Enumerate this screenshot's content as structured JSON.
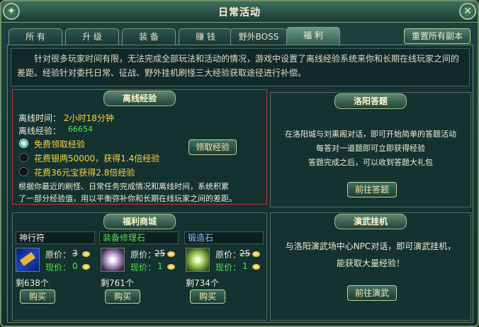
{
  "window": {
    "title": "日常活动"
  },
  "tabs": [
    {
      "label": "所 有"
    },
    {
      "label": "升 级"
    },
    {
      "label": "装 备"
    },
    {
      "label": "赚 钱"
    },
    {
      "label": "野外BOSS"
    },
    {
      "label": "福 利"
    }
  ],
  "reset_button": "重置所有副本",
  "intro": "针对很多玩家时间有限，无法完成全部玩法和活动的情况，游戏中设置了离线经验系统来你和长期在线玩家之间的差距。经验针对委托日常、征战、野外挂机刷怪三大经验获取途径进行补偿。",
  "offline": {
    "title": "离线经验",
    "time_label": "离线时间：",
    "time_value": "2小时18分钟",
    "exp_label": "离线经验：",
    "exp_value": "66654",
    "options": [
      "免费领取经验",
      "花费银两50000，获得1.4倍经验",
      "花费36元宝获得2.8倍经验"
    ],
    "claim_button": "领取经验",
    "desc_line1": "根据你最近的刷怪、日常任务完成情况和离线时间，系统积累",
    "desc_line2": "了一部分经验值，用以平衡弥补你和长期在线玩家之间的差距。"
  },
  "quiz": {
    "title": "洛阳答题",
    "line1": "在洛阳城与刘熏阁对话，即可开始简单的答题活动",
    "line2": "每答对一道题即可立即获得经验",
    "line3": "答题完成之后，可以收到答题大礼包",
    "button": "前往答题"
  },
  "shop": {
    "title": "福利商城",
    "items": [
      {
        "name": "神行符",
        "price_label": "原价：",
        "price": "3",
        "now_label": "现价：",
        "now": "0",
        "stock": "剩638个",
        "buy": "购买"
      },
      {
        "name": "装备修理石",
        "price_label": "原价：",
        "price": "25",
        "now_label": "现价：",
        "now": "1",
        "stock": "剩761个",
        "buy": "购买"
      },
      {
        "name": "锻造石",
        "price_label": "原价：",
        "price": "25",
        "now_label": "现价：",
        "now": "1",
        "stock": "剩734个",
        "buy": "购买"
      }
    ]
  },
  "martial": {
    "title": "演武挂机",
    "line1": "与洛阳演武场中心NPC对话，即可演武挂机，",
    "line2": "能获取大量经验！",
    "button": "前往演武"
  }
}
